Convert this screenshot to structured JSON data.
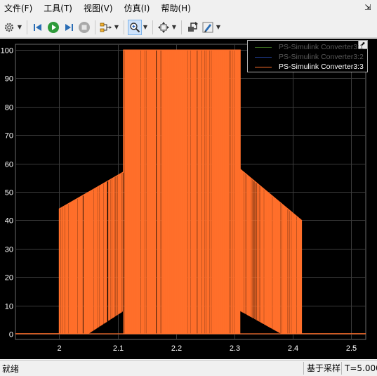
{
  "menubar": {
    "items": [
      "文件(F)",
      "工具(T)",
      "视图(V)",
      "仿真(I)",
      "帮助(H)"
    ],
    "collapse_glyph": "⇲"
  },
  "toolbar": {
    "icons": [
      "gear-icon",
      "step-back-icon",
      "run-icon",
      "step-forward-icon",
      "stop-icon",
      "signal-selector-icon",
      "zoom-in-icon",
      "fit-to-view-icon",
      "highlight-block-icon",
      "style-pen-icon"
    ]
  },
  "legend": {
    "entries": [
      {
        "name": "PS-Simulink Converter3:1",
        "color": "#3a6b1f",
        "active": false
      },
      {
        "name": "PS-Simulink Converter3:2",
        "color": "#1f3a8a",
        "active": false
      },
      {
        "name": "PS-Simulink Converter3:3",
        "color": "#ff6f2a",
        "active": true
      }
    ]
  },
  "chart_data": {
    "type": "line",
    "y_ticks": [
      "0",
      "10",
      "20",
      "30",
      "40",
      "50",
      "60",
      "70",
      "80",
      "90",
      "100"
    ],
    "x_ticks": [
      "2",
      "2.1",
      "2.2",
      "2.3",
      "2.4",
      "2.5"
    ],
    "xlim": [
      1.925,
      2.525
    ],
    "ylim": [
      -2,
      102
    ],
    "grid": true,
    "background": "#000000",
    "series_color": "#ff6f2a",
    "series": [
      {
        "name": "PS-Simulink Converter3:3",
        "envelope": {
          "x": [
            1.925,
            2.0,
            2.0,
            2.11,
            2.11,
            2.31,
            2.31,
            2.415,
            2.415,
            2.525
          ],
          "upper": [
            0,
            0,
            44,
            57,
            100,
            100,
            58,
            40,
            0,
            0
          ],
          "lower": [
            0,
            0,
            0,
            0,
            0,
            0,
            0,
            0,
            0,
            0
          ]
        },
        "sawtooth_base": {
          "rise": {
            "x0": 2.05,
            "y0": 0,
            "x1": 2.11,
            "y1": 8
          },
          "fall": {
            "x0": 2.31,
            "y0": 8,
            "x1": 2.38,
            "y1": 0
          }
        }
      }
    ]
  },
  "status": {
    "left": "就绪",
    "sample_based": "基于采样",
    "time": "T=5.000"
  }
}
